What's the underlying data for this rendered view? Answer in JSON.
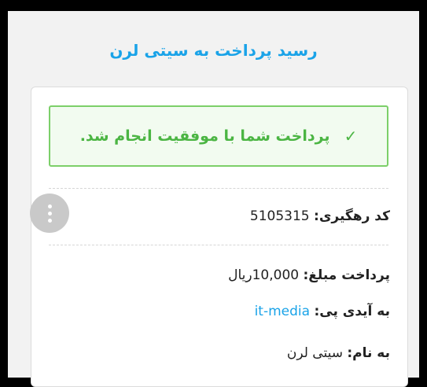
{
  "page": {
    "title": "رسید پرداخت به سیتی لرن"
  },
  "alert": {
    "icon": "check-icon",
    "message": "پرداخت شما با موفقیت انجام شد."
  },
  "receipt": {
    "tracking_label": "کد رهگیری:",
    "tracking_value": "5105315",
    "amount_label": "پرداخت مبلغ:",
    "amount_value": "10,000",
    "amount_unit": "ریال",
    "payid_label": "به آیدی پی:",
    "payid_value": "it-media",
    "name_label": "به نام:",
    "name_value": "سیتی لرن"
  },
  "menu": {
    "icon": "more-vertical-icon"
  },
  "colors": {
    "accent": "#1aa3e8",
    "success": "#4bb543",
    "success_border": "#7ccf69"
  }
}
